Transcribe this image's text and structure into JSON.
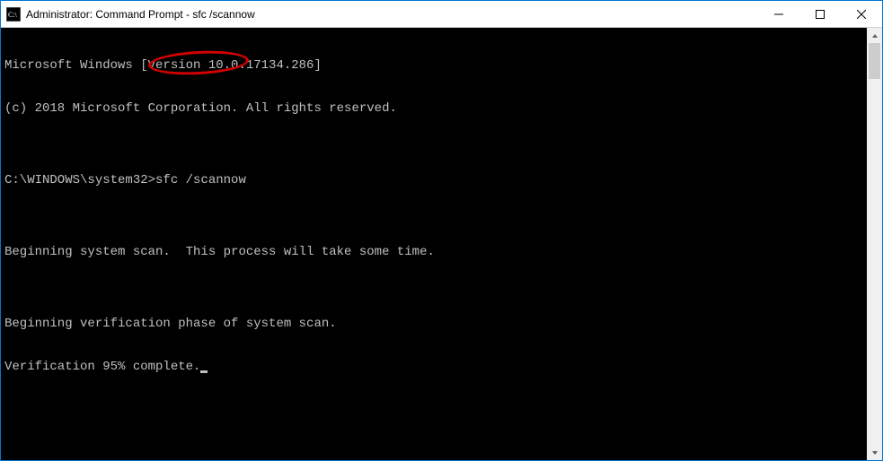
{
  "titlebar": {
    "title": "Administrator: Command Prompt - sfc  /scannow"
  },
  "console": {
    "line1": "Microsoft Windows [Version 10.0.17134.286]",
    "line2": "(c) 2018 Microsoft Corporation. All rights reserved.",
    "line3_blank": "",
    "prompt_path": "C:\\WINDOWS\\system32>",
    "prompt_command": "sfc /scannow",
    "line5_blank": "",
    "line6": "Beginning system scan.  This process will take some time.",
    "line7_blank": "",
    "line8": "Beginning verification phase of system scan.",
    "line9": "Verification 95% complete."
  }
}
